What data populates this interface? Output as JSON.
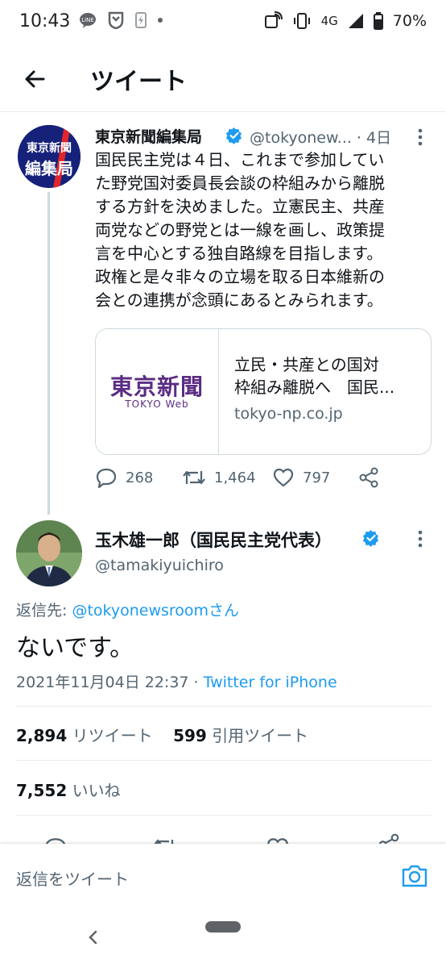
{
  "status_bar": {
    "time": "10:43",
    "network": "4G",
    "battery": "70%",
    "icons": [
      "line-icon",
      "shield-icon",
      "flash-icon",
      "dot-icon",
      "nfc-icon",
      "vibrate-icon",
      "signal-icon",
      "battery-icon"
    ]
  },
  "header": {
    "title": "ツイート",
    "back_icon": "back-arrow-icon"
  },
  "tweet1": {
    "avatar_text_top": "東京新聞",
    "avatar_text_bottom": "編集局",
    "name": "東京新聞編集局",
    "handle": "@tokyonew...",
    "time": "· 4日",
    "body_lines": [
      "国民民主党は４日、これまで参加してい",
      "た野党国対委員長会談の枠組みから離脱",
      "する方針を決めました。立憲民主、共産",
      "両党などの野党とは一線を画し、政策提",
      "言を中心とする独自路線を目指します。",
      "政権と是々非々の立場を取る日本維新の",
      "会との連携が念頭にあるとみられます。"
    ],
    "card": {
      "logo": "東京新聞",
      "logo_sub": "TOKYO Web",
      "title_line1": "立民・共産との国対",
      "title_line2": "枠組み離脱へ　国民...",
      "domain": "tokyo-np.co.jp"
    },
    "actions": {
      "replies": "268",
      "retweets": "1,464",
      "likes": "797"
    }
  },
  "tweet2": {
    "name": "玉木雄一郎（国民民主党代表）",
    "handle": "@tamakiyuichiro",
    "reply_prefix": "返信先: ",
    "reply_link": "@tokyonewsroomさん",
    "body": "ないです。",
    "date": "2021年11月04日 22:37 · ",
    "client": "Twitter for iPhone",
    "retweets_count": "2,894",
    "retweets_label": "リツイート",
    "quotes_count": "599",
    "quotes_label": "引用ツイート",
    "likes_count": "7,552",
    "likes_label": "いいね"
  },
  "reply_bar": {
    "placeholder": "返信をツイート"
  },
  "colors": {
    "accent": "#1d9bf0",
    "text": "#0f1419",
    "muted": "#536471",
    "verified": "#1d9bf0"
  }
}
